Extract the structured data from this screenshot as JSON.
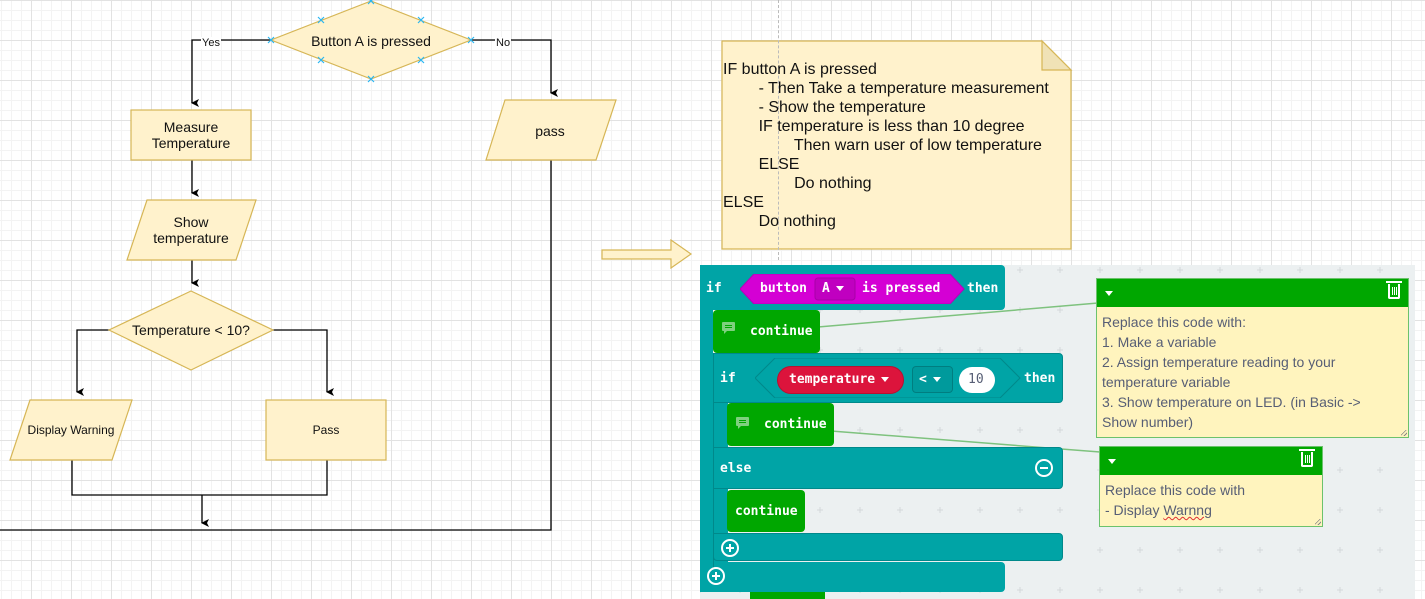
{
  "flowchart": {
    "nodes": {
      "decision_button": "Button A is pressed",
      "measure": "Measure Temperature",
      "show": "Show temperature",
      "decision_temp": "Temperature < 10?",
      "display_warning": "Display Warning",
      "pass_inner": "Pass",
      "pass_outer": "pass"
    },
    "edge_labels": {
      "yes": "Yes",
      "no": "No"
    },
    "colors": {
      "fill": "#fff2cc",
      "stroke": "#d6b656",
      "selection": "#29b6f2"
    }
  },
  "pseudocode_note": {
    "lines": [
      "IF button A is pressed",
      "        - Then Take a temperature measurement",
      "        - Show the temperature",
      "        IF temperature is less than 10 degree",
      "                Then warn user of low temperature",
      "        ELSE",
      "                Do nothing",
      "ELSE",
      "        Do nothing"
    ]
  },
  "makecode": {
    "outer_if": {
      "if": "if",
      "sensor": "button",
      "button_value": "A",
      "is_pressed": "is pressed",
      "then": "then"
    },
    "continue_1": "continue",
    "inner_if": {
      "if": "if",
      "variable": "temperature",
      "operator": "<",
      "value": "10",
      "then": "then"
    },
    "continue_2": "continue",
    "else": "else",
    "continue_3": "continue",
    "comment_1": {
      "lines": [
        "Replace this code with:",
        "1. Make a variable",
        "2. Assign temperature reading to your",
        "temperature variable",
        "3. Show temperature on LED. (in Basic ->",
        "Show number)"
      ]
    },
    "comment_2": {
      "line1": "Replace this code with",
      "line2_prefix": "- Display ",
      "line2_misspelled": "Warnng"
    },
    "colors": {
      "logic": "#00a4a6",
      "button": "#d400d4",
      "variable": "#dc143c",
      "loops": "#00a700",
      "comment": "#fff4be"
    }
  }
}
